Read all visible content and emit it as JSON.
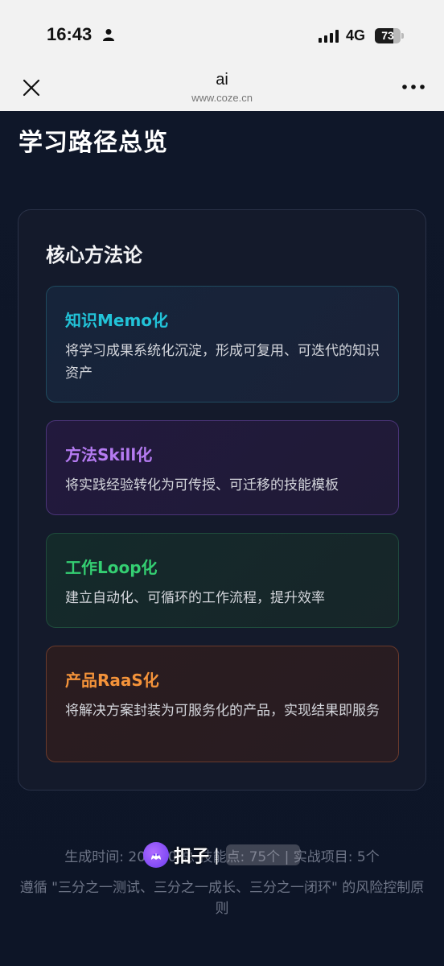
{
  "status_bar": {
    "time": "16:43",
    "network": "4G",
    "battery_percent": 73,
    "battery_label": "73"
  },
  "nav": {
    "title": "ai",
    "url": "www.coze.cn"
  },
  "section_title": "学习路径总览",
  "panel": {
    "title": "核心方法论",
    "cards": [
      {
        "title": "知识Memo化",
        "desc": "将学习成果系统化沉淀，形成可复用、可迭代的知识资产",
        "color": "#22c3d8"
      },
      {
        "title": "方法Skill化",
        "desc": "将实践经验转化为可传授、可迁移的技能模板",
        "color": "#b57bf2"
      },
      {
        "title": "工作Loop化",
        "desc": "建立自动化、可循环的工作流程，提升效率",
        "color": "#34cf72"
      },
      {
        "title": "产品RaaS化",
        "desc": "将解决方案封装为可服务化的产品，实现结果即服务",
        "color": "#f4933a"
      }
    ]
  },
  "footer": {
    "line1": "生成时间: 2026-0  总 技能点: 75个 | 实战项目: 5个",
    "line2": "遵循 \"三分之一测试、三分之一成长、三分之一闭环\" 的风险控制原则"
  },
  "brand": {
    "name": "扣子",
    "separator": "|"
  }
}
